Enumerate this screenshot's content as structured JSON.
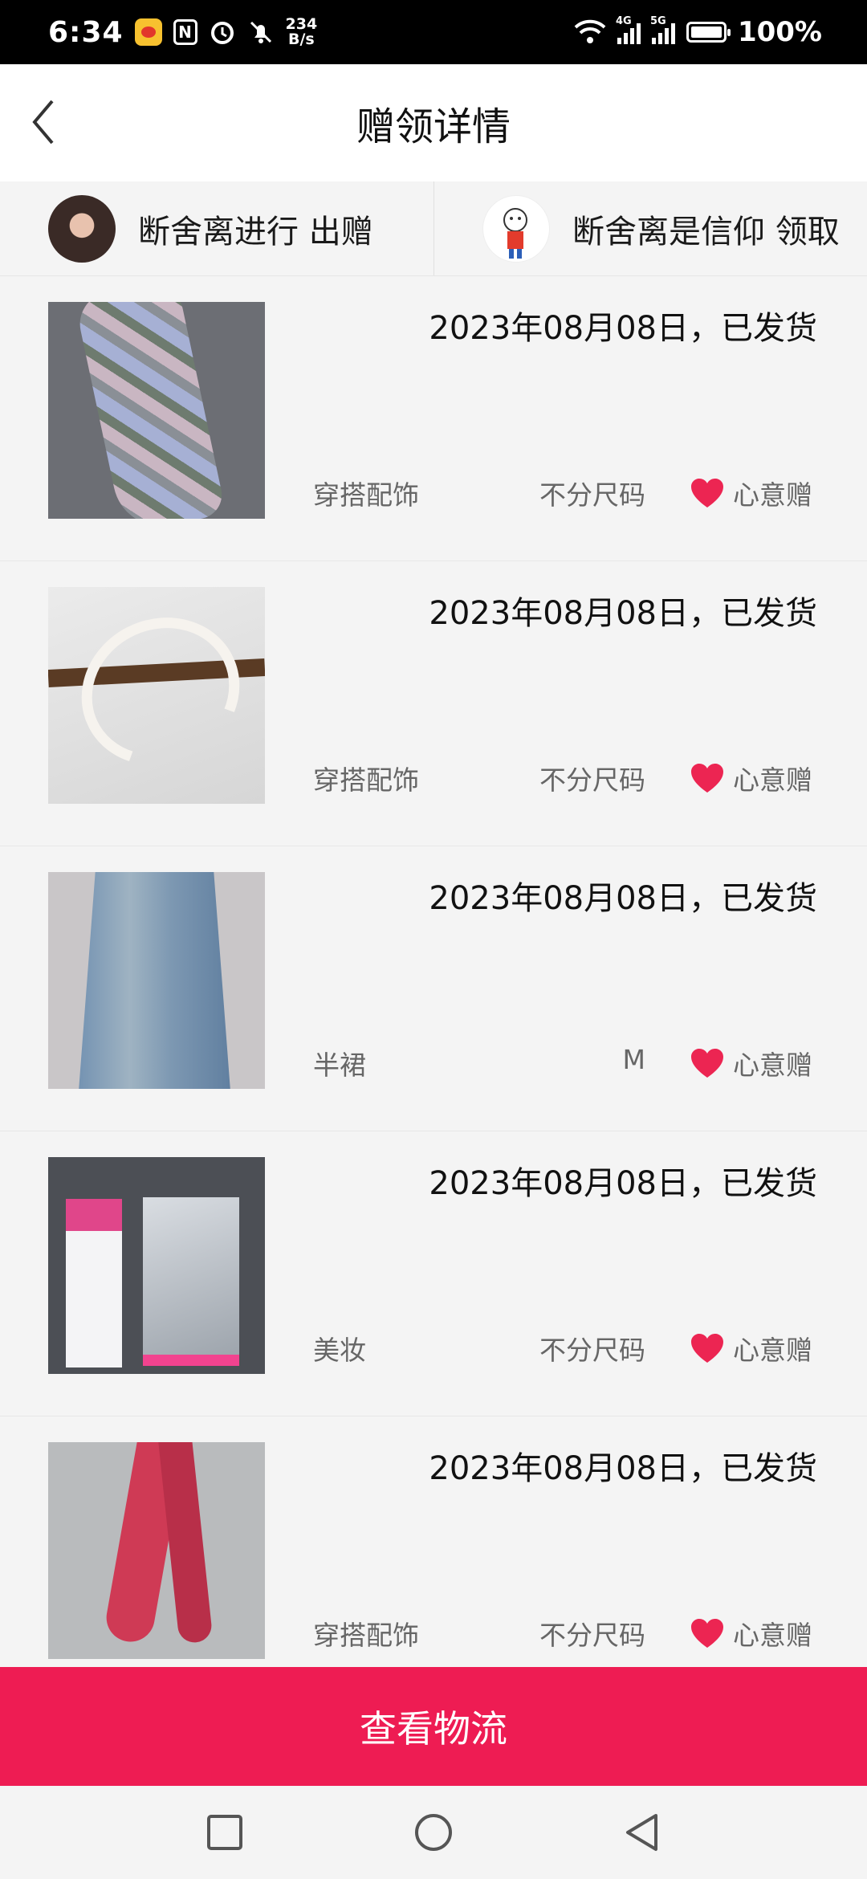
{
  "status_bar": {
    "time": "6:34",
    "net_speed_value": "234",
    "net_speed_unit": "B/s",
    "signal_1": "4G",
    "signal_2": "5G",
    "battery": "100%"
  },
  "header": {
    "title": "赠领详情"
  },
  "participants": {
    "giver": "断舍离进行 出赠",
    "receiver": "断舍离是信仰 领取"
  },
  "items": [
    {
      "date": "2023年08月08日，已发货",
      "category": "穿搭配饰",
      "size": "不分尺码",
      "gift_type": "心意赠"
    },
    {
      "date": "2023年08月08日，已发货",
      "category": "穿搭配饰",
      "size": "不分尺码",
      "gift_type": "心意赠"
    },
    {
      "date": "2023年08月08日，已发货",
      "category": "半裙",
      "size": "M",
      "gift_type": "心意赠"
    },
    {
      "date": "2023年08月08日，已发货",
      "category": "美妆",
      "size": "不分尺码",
      "gift_type": "心意赠"
    },
    {
      "date": "2023年08月08日，已发货",
      "category": "穿搭配饰",
      "size": "不分尺码",
      "gift_type": "心意赠"
    }
  ],
  "footer": {
    "button_label": "查看物流"
  },
  "colors": {
    "accent": "#ee1c53",
    "heart": "#ec2552"
  },
  "icons": [
    "back-arrow-icon",
    "heart-icon",
    "square-nav-icon",
    "circle-nav-icon",
    "triangle-back-icon"
  ]
}
